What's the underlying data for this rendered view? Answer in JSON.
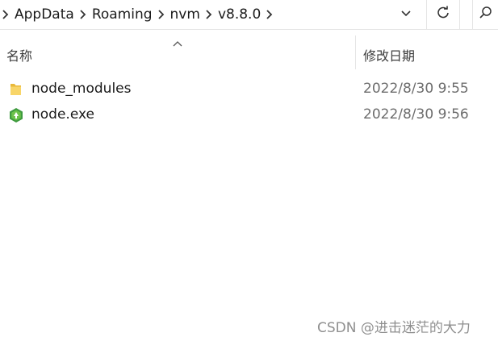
{
  "address_bar": {
    "breadcrumbs": [
      "AppData",
      "Roaming",
      "nvm",
      "v8.8.0"
    ],
    "dropdown_icon": "chevron-down-icon",
    "refresh_icon": "refresh-icon",
    "search_icon": "search-icon"
  },
  "columns": {
    "name_label": "名称",
    "date_label": "修改日期",
    "sort_indicator": "ascending"
  },
  "files": [
    {
      "name": "node_modules",
      "date": "2022/8/30 9:55",
      "icon": "folder-icon"
    },
    {
      "name": "node.exe",
      "date": "2022/8/30 9:56",
      "icon": "nodejs-icon"
    }
  ],
  "watermark": "CSDN @进击迷茫的大力",
  "colors": {
    "folder": "#f5c842",
    "node_green": "#4caf50",
    "divider": "#e5e5e5"
  }
}
